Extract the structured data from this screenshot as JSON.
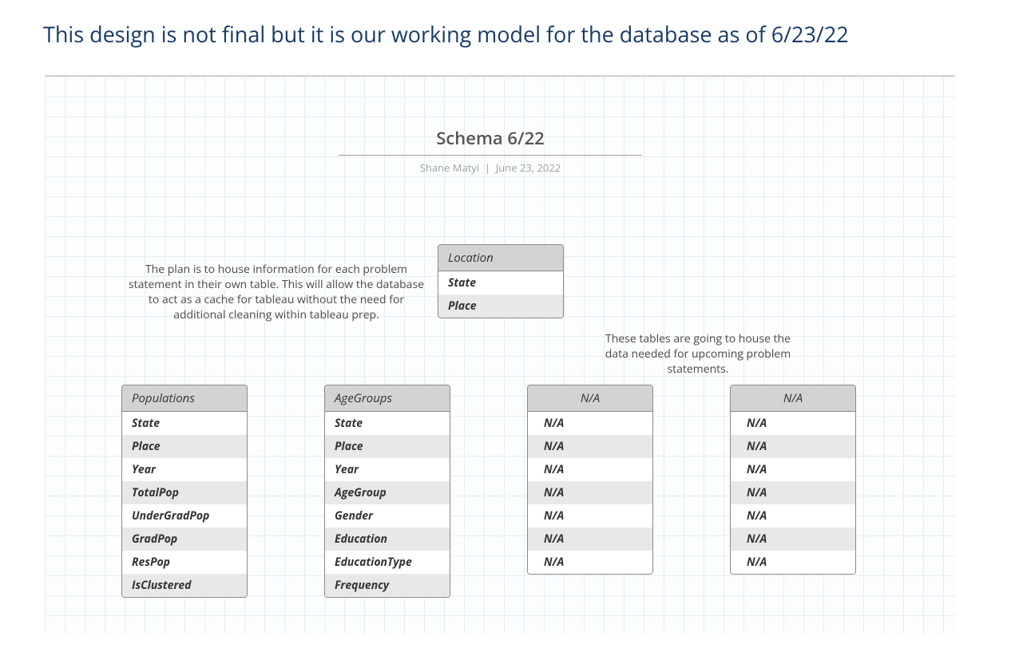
{
  "heading": "This design is not final but it is our working model for the database as of 6/23/22",
  "schema": {
    "title": "Schema 6/22",
    "author": "Shane Matyi",
    "date": "June 23, 2022"
  },
  "notes": {
    "left": "The plan is to house information for each problem statement in their own table. This will allow the database to act as a cache for tableau without the need for additional cleaning within tableau prep.",
    "right": "These tables are going to house the data needed for upcoming problem statements."
  },
  "tables": {
    "location": {
      "name": "Location",
      "fields": [
        "State",
        "Place"
      ]
    },
    "populations": {
      "name": "Populations",
      "fields": [
        "State",
        "Place",
        "Year",
        "TotalPop",
        "UnderGradPop",
        "GradPop",
        "ResPop",
        "IsClustered"
      ]
    },
    "agegroups": {
      "name": "AgeGroups",
      "fields": [
        "State",
        "Place",
        "Year",
        "AgeGroup",
        "Gender",
        "Education",
        "EducationType",
        "Frequency"
      ]
    },
    "na1": {
      "name": "N/A",
      "fields": [
        "N/A",
        "N/A",
        "N/A",
        "N/A",
        "N/A",
        "N/A",
        "N/A"
      ]
    },
    "na2": {
      "name": "N/A",
      "fields": [
        "N/A",
        "N/A",
        "N/A",
        "N/A",
        "N/A",
        "N/A",
        "N/A"
      ]
    }
  }
}
